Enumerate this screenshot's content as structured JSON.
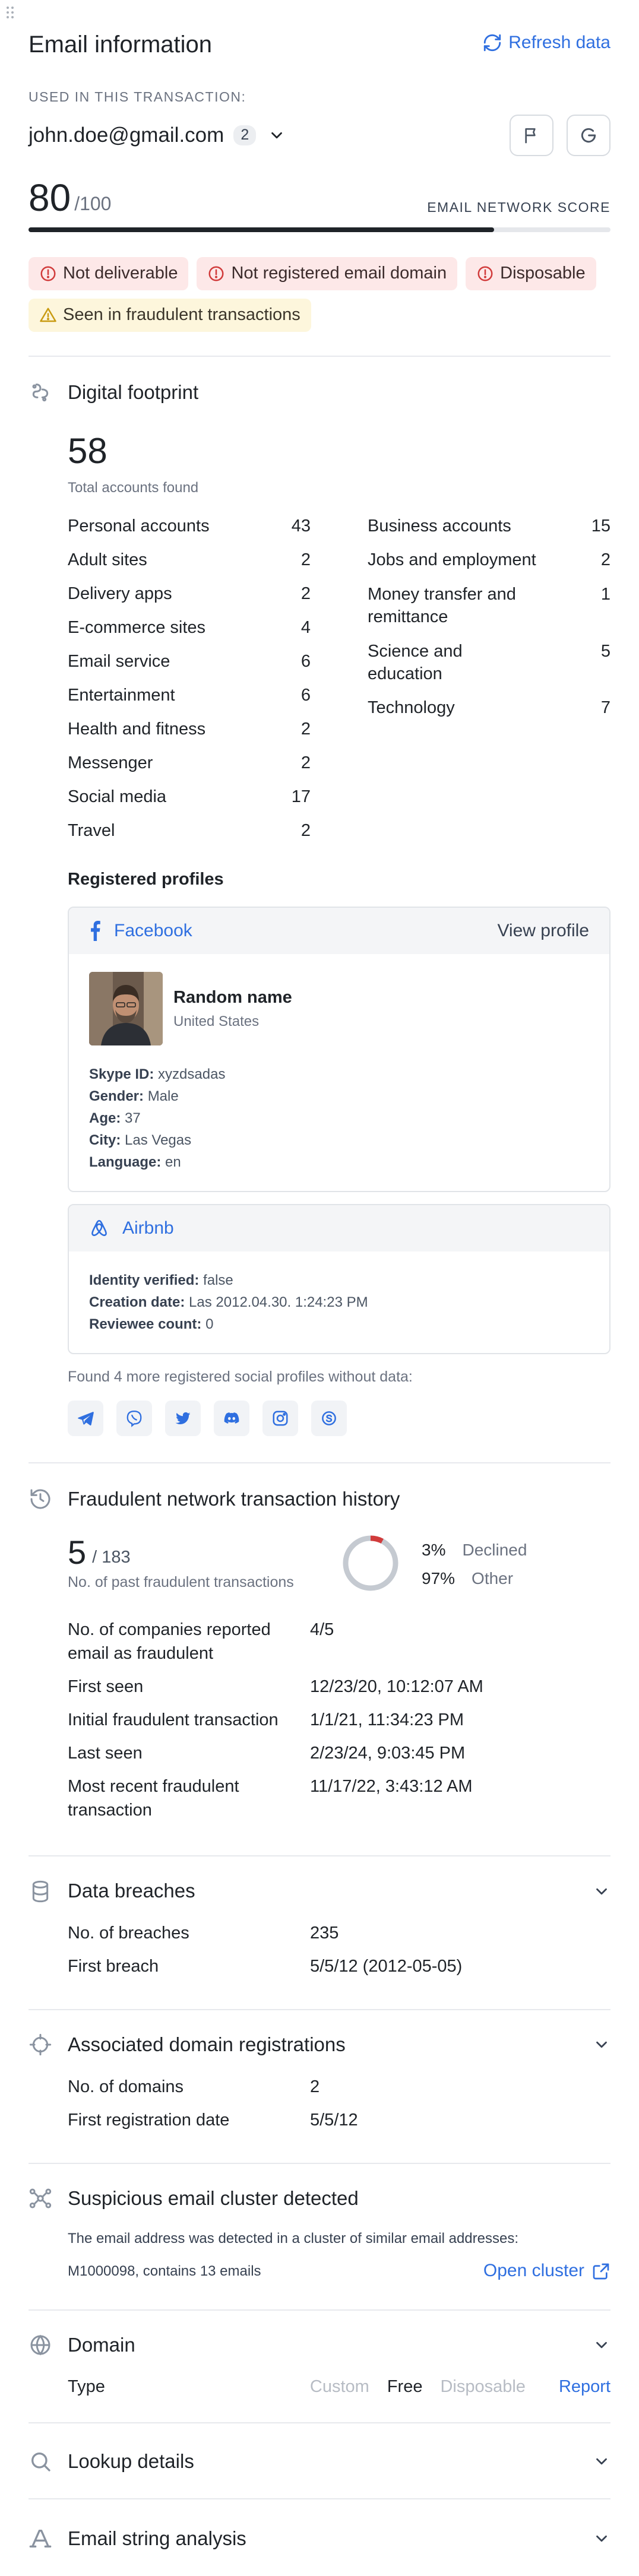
{
  "header": {
    "title": "Email information",
    "refresh_label": "Refresh data"
  },
  "email": {
    "used_label": "USED IN THIS TRANSACTION:",
    "address": "john.doe@gmail.com",
    "count": "2"
  },
  "score": {
    "value": "80",
    "max": "/100",
    "label": "EMAIL NETWORK SCORE",
    "fraction": 0.8
  },
  "tags": [
    {
      "label": "Not deliverable",
      "kind": "error"
    },
    {
      "label": "Not registered email domain",
      "kind": "error"
    },
    {
      "label": "Disposable",
      "kind": "error"
    },
    {
      "label": "Seen in fraudulent transactions",
      "kind": "warning"
    }
  ],
  "footprint": {
    "title": "Digital footprint",
    "total": "58",
    "total_label": "Total accounts found",
    "personal": {
      "label": "Personal accounts",
      "count": "43",
      "items": [
        {
          "name": "Adult sites",
          "count": "2"
        },
        {
          "name": "Delivery apps",
          "count": "2"
        },
        {
          "name": "E-commerce sites",
          "count": "4"
        },
        {
          "name": "Email service",
          "count": "6"
        },
        {
          "name": "Entertainment",
          "count": "6"
        },
        {
          "name": "Health and fitness",
          "count": "2"
        },
        {
          "name": "Messenger",
          "count": "2"
        },
        {
          "name": "Social media",
          "count": "17"
        },
        {
          "name": "Travel",
          "count": "2"
        }
      ]
    },
    "business": {
      "label": "Business accounts",
      "count": "15",
      "items": [
        {
          "name": "Jobs and employment",
          "count": "2"
        },
        {
          "name": "Money transfer and remittance",
          "count": "1"
        },
        {
          "name": "Science and education",
          "count": "5"
        },
        {
          "name": "Technology",
          "count": "7"
        }
      ]
    },
    "profiles_title": "Registered profiles",
    "facebook": {
      "name": "Facebook",
      "view": "View profile",
      "person_name": "Random name",
      "country": "United States",
      "fields": [
        {
          "k": "Skype ID:",
          "v": "xyzdsadas"
        },
        {
          "k": "Gender:",
          "v": "Male"
        },
        {
          "k": "Age:",
          "v": "37"
        },
        {
          "k": "City:",
          "v": "Las Vegas"
        },
        {
          "k": "Language:",
          "v": "en"
        }
      ]
    },
    "airbnb": {
      "name": "Airbnb",
      "fields": [
        {
          "k": "Identity verified:",
          "v": "false"
        },
        {
          "k": "Creation date:",
          "v": "Las 2012.04.30. 1:24:23 PM"
        },
        {
          "k": "Reviewee count:",
          "v": "0"
        }
      ]
    },
    "more_text": "Found 4 more registered social profiles without data:",
    "more_icons": [
      "telegram-icon",
      "viber-icon",
      "twitter-icon",
      "discord-icon",
      "instagram-icon",
      "skype-icon"
    ]
  },
  "fraud": {
    "title": "Fraudulent network transaction history",
    "count": "5",
    "total": "/ 183",
    "count_label": "No. of past fraudulent transactions",
    "declined_pct": "3%",
    "declined_label": "Declined",
    "other_pct": "97%",
    "other_label": "Other",
    "declined_fraction": 0.03,
    "rows": [
      {
        "k": "No. of companies reported email as fraudulent",
        "v": "4/5"
      },
      {
        "k": "First seen",
        "v": "12/23/20, 10:12:07 AM"
      },
      {
        "k": "Initial fraudulent transaction",
        "v": "1/1/21, 11:34:23 PM"
      },
      {
        "k": "Last seen",
        "v": "2/23/24, 9:03:45 PM"
      },
      {
        "k": "Most recent fraudulent transaction",
        "v": "11/17/22, 3:43:12 AM"
      }
    ]
  },
  "breaches": {
    "title": "Data breaches",
    "rows": [
      {
        "k": "No. of breaches",
        "v": "235"
      },
      {
        "k": "First breach",
        "v": "5/5/12 (2012-05-05)"
      }
    ]
  },
  "domains": {
    "title": "Associated domain registrations",
    "rows": [
      {
        "k": "No. of domains",
        "v": "2"
      },
      {
        "k": "First registration date",
        "v": "5/5/12"
      }
    ]
  },
  "cluster": {
    "title": "Suspicious email cluster detected",
    "text": "The email address was detected in a cluster of similar email addresses:",
    "cluster_id": "M1000098, contains 13 emails",
    "open_label": "Open cluster"
  },
  "domain": {
    "title": "Domain",
    "type_label": "Type",
    "options": [
      "Custom",
      "Free",
      "Disposable"
    ],
    "selected": "Free",
    "report_label": "Report"
  },
  "lookup": {
    "title": "Lookup details"
  },
  "string_analysis": {
    "title": "Email string analysis"
  },
  "colors": {
    "accent": "#2f6fe0",
    "error": "#d13b3b",
    "warning": "#e8b92c",
    "tag_error_bg": "#fde8e8",
    "tag_warning_bg": "#fdf6dc"
  }
}
